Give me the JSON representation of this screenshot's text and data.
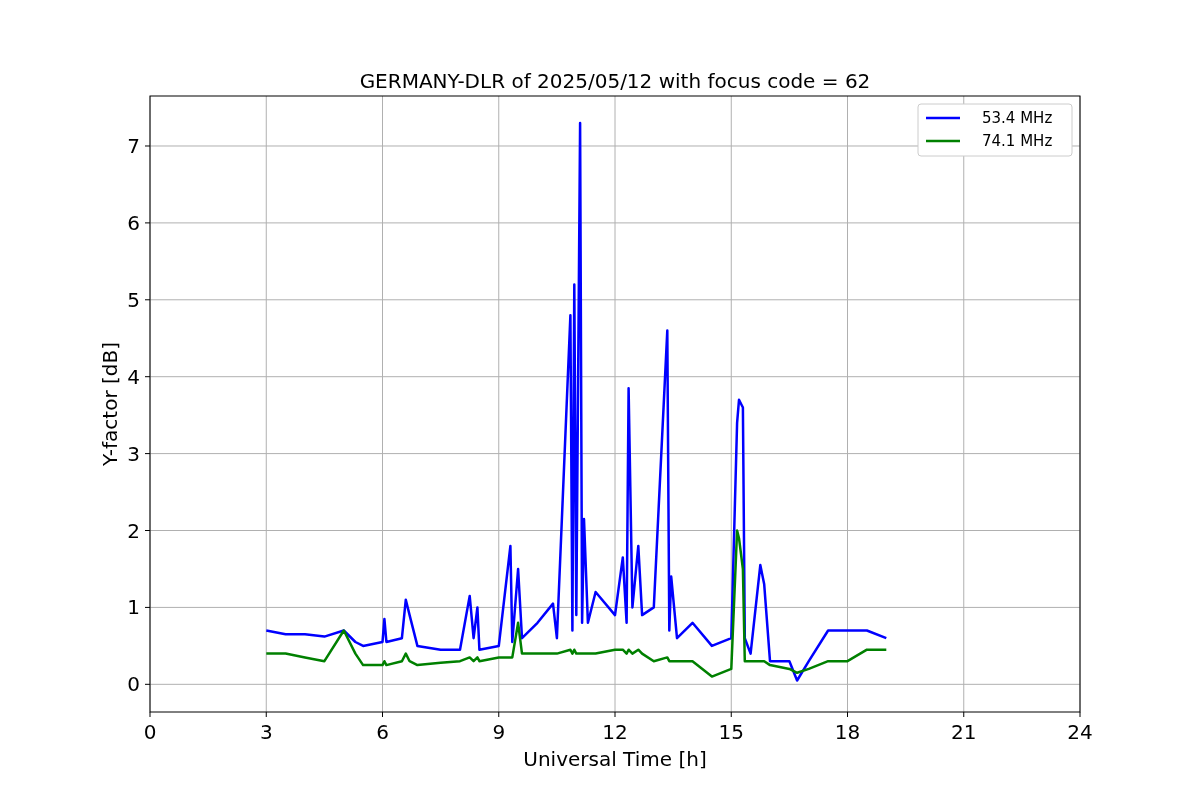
{
  "chart_data": {
    "type": "line",
    "title": "GERMANY-DLR of 2025/05/12 with focus code = 62",
    "xlabel": "Universal Time [h]",
    "ylabel": "Y-factor [dB]",
    "x": [
      3.0,
      3.5,
      4.0,
      4.5,
      5.0,
      5.3,
      5.5,
      6.0,
      6.05,
      6.1,
      6.5,
      6.6,
      6.7,
      6.9,
      7.5,
      8.0,
      8.25,
      8.35,
      8.45,
      8.5,
      9.0,
      9.3,
      9.35,
      9.5,
      9.6,
      10.0,
      10.4,
      10.5,
      10.85,
      10.9,
      10.95,
      11.0,
      11.1,
      11.15,
      11.2,
      11.3,
      11.5,
      12.0,
      12.2,
      12.3,
      12.35,
      12.45,
      12.6,
      12.7,
      13.0,
      13.35,
      13.4,
      13.45,
      13.6,
      14.0,
      14.5,
      15.0,
      15.15,
      15.2,
      15.3,
      15.35,
      15.5,
      15.75,
      15.85,
      16.0,
      16.5,
      16.7,
      17.0,
      17.5,
      18.0,
      18.5,
      19.0
    ],
    "series": [
      {
        "name": "53.4 MHz",
        "color": "#0000ff",
        "values": [
          0.7,
          0.65,
          0.65,
          0.62,
          0.7,
          0.55,
          0.5,
          0.55,
          0.85,
          0.55,
          0.6,
          1.1,
          0.9,
          0.5,
          0.45,
          0.45,
          1.15,
          0.6,
          1.0,
          0.45,
          0.5,
          1.8,
          0.55,
          1.5,
          0.6,
          0.8,
          1.05,
          0.6,
          4.8,
          0.7,
          5.2,
          0.9,
          7.3,
          0.8,
          2.15,
          0.8,
          1.2,
          0.9,
          1.65,
          0.8,
          3.85,
          1.0,
          1.8,
          0.9,
          1.0,
          4.6,
          0.7,
          1.4,
          0.6,
          0.8,
          0.5,
          0.6,
          3.4,
          3.7,
          3.6,
          0.6,
          0.4,
          1.55,
          1.3,
          0.3,
          0.3,
          0.05,
          0.3,
          0.7,
          0.7,
          0.7,
          0.6
        ]
      },
      {
        "name": "74.1 MHz",
        "color": "#008000",
        "values": [
          0.4,
          0.4,
          0.35,
          0.3,
          0.7,
          0.4,
          0.25,
          0.25,
          0.3,
          0.25,
          0.3,
          0.4,
          0.3,
          0.25,
          0.28,
          0.3,
          0.35,
          0.3,
          0.35,
          0.3,
          0.35,
          0.35,
          0.35,
          0.8,
          0.4,
          0.4,
          0.4,
          0.4,
          0.45,
          0.4,
          0.45,
          0.4,
          0.4,
          0.4,
          0.4,
          0.4,
          0.4,
          0.45,
          0.45,
          0.4,
          0.45,
          0.4,
          0.45,
          0.4,
          0.3,
          0.35,
          0.3,
          0.3,
          0.3,
          0.3,
          0.1,
          0.2,
          2.0,
          1.9,
          1.5,
          0.3,
          0.3,
          0.3,
          0.3,
          0.25,
          0.2,
          0.15,
          0.2,
          0.3,
          0.3,
          0.45,
          0.45
        ]
      }
    ],
    "grid": true,
    "legend": true,
    "xlim": [
      0,
      24
    ],
    "ylim": [
      -0.36,
      7.65
    ],
    "xticks": [
      0,
      3,
      6,
      9,
      12,
      15,
      18,
      21,
      24
    ],
    "yticks": [
      0,
      1,
      2,
      3,
      4,
      5,
      6,
      7
    ]
  }
}
